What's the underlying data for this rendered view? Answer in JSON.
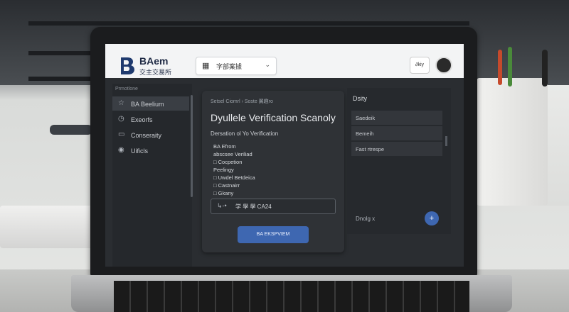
{
  "header": {
    "logo_text": "BAem",
    "logo_sub": "交主交易所",
    "dropdown_label": "字部案據",
    "user_label": "∂kiy"
  },
  "sidebar": {
    "section": "Prmotlone",
    "items": [
      {
        "label": "BA Beelium",
        "icon": "star-icon"
      },
      {
        "label": "Exeorfs",
        "icon": "clock-icon"
      },
      {
        "label": "Conseraity",
        "icon": "folder-icon"
      },
      {
        "label": "Uificls",
        "icon": "settings-icon"
      }
    ]
  },
  "main": {
    "breadcrumb": "Setsel Ciomrl › Soste 翼趣ro",
    "title": "Dyullele Verification Scanoly",
    "subtitle": "Dersation ol Yo Verification",
    "lines": [
      "BA Efrom",
      "abscsee Veriliad",
      "□  Cocpetion",
      "Peelingy",
      "□  Uwdel Betdeica",
      "□  Castnairr",
      "□  Gkany"
    ],
    "input_icon": "↳-•",
    "input_value": "学 學 學 CA24",
    "cta_label": "BA EKSPVIEM"
  },
  "right": {
    "title": "Dsity",
    "items": [
      "Saedeik",
      "Bemeih",
      "Fast rtrespe"
    ],
    "link": "Dnolg x",
    "fab": "+"
  },
  "colors": {
    "accent": "#3e67b1",
    "panel": "#2f3236",
    "header_bg": "#f3f4f5"
  }
}
